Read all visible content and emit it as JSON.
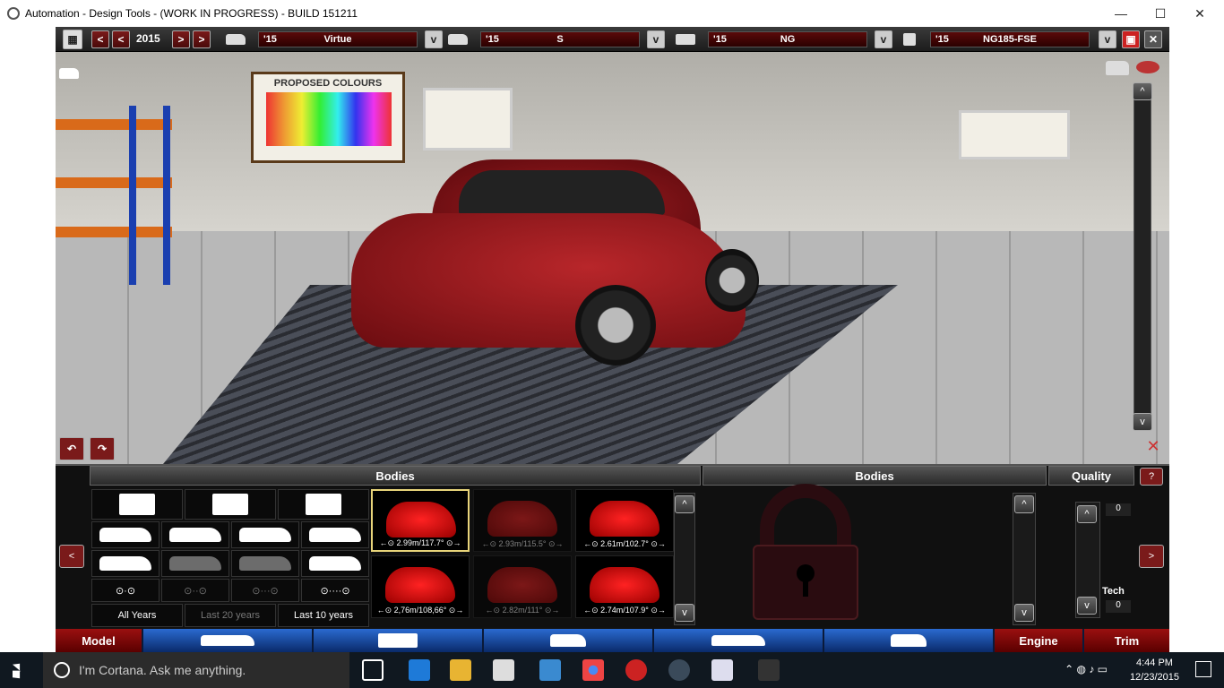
{
  "window": {
    "title": "Automation - Design Tools - (WORK IN PROGRESS) - BUILD 151211",
    "minimize": "—",
    "maximize": "☐",
    "close": "✕"
  },
  "topbar": {
    "year": "2015",
    "prev2": "<",
    "prev1": "<",
    "next1": ">",
    "next2": ">",
    "model": {
      "year": "'15",
      "name": "Virtue"
    },
    "trim": {
      "year": "'15",
      "name": "S"
    },
    "body": {
      "year": "'15",
      "name": "NG"
    },
    "engine": {
      "year": "'15",
      "name": "NG185-FSE"
    },
    "dropdown": "v"
  },
  "poster": {
    "text": "PROPOSED COLOURS"
  },
  "panels": {
    "bodies_left": "Bodies",
    "bodies_right": "Bodies",
    "quality": "Quality",
    "help": "?",
    "nav_prev": "<",
    "nav_next": ">",
    "year_filters": [
      "All Years",
      "Last 20 years",
      "Last 10 years"
    ],
    "thumbs": [
      {
        "caption": "←⊙ 2.99m/117.7° ⊙→"
      },
      {
        "caption": "←⊙ 2.93m/115.5° ⊙→"
      },
      {
        "caption": "←⊙ 2.61m/102.7° ⊙→"
      },
      {
        "caption": "←⊙ 2,76m/108,66° ⊙→"
      },
      {
        "caption": "←⊙ 2.82m/111° ⊙→"
      },
      {
        "caption": "←⊙ 2.74m/107.9° ⊙→"
      }
    ],
    "scroll_up": "^",
    "scroll_down": "v",
    "quality_value": "0",
    "tech_label": "Tech",
    "tech_value": "0"
  },
  "tabs": {
    "model": "Model",
    "engine": "Engine",
    "trim": "Trim"
  },
  "taskbar": {
    "cortana": "I'm Cortana. Ask me anything.",
    "time": "4:44 PM",
    "date": "12/23/2015"
  }
}
